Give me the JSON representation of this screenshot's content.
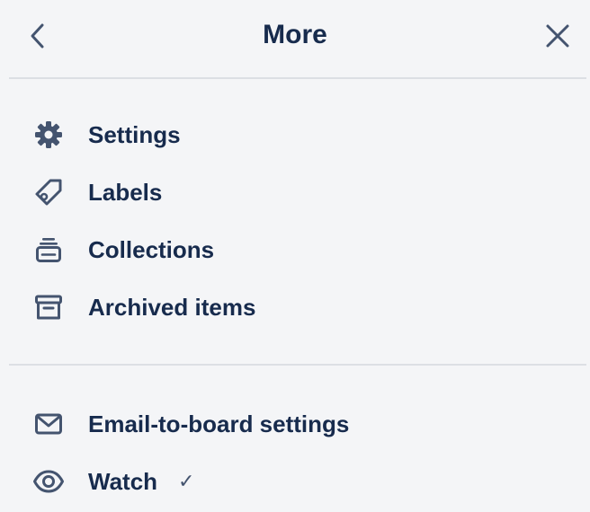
{
  "header": {
    "title": "More",
    "back_icon": "chevron-left-icon",
    "close_icon": "close-icon"
  },
  "menu": {
    "primary": [
      {
        "label": "Settings",
        "icon": "gear-icon"
      },
      {
        "label": "Labels",
        "icon": "tag-icon"
      },
      {
        "label": "Collections",
        "icon": "collections-icon"
      },
      {
        "label": "Archived items",
        "icon": "archive-icon"
      }
    ],
    "secondary": [
      {
        "label": "Email-to-board settings",
        "icon": "email-icon"
      },
      {
        "label": "Watch",
        "icon": "eye-icon",
        "checked": true,
        "check_mark": "✓"
      }
    ]
  },
  "colors": {
    "background": "#f4f5f7",
    "text": "#172b4d",
    "icon": "#44546f",
    "divider": "#dcdfe4"
  }
}
